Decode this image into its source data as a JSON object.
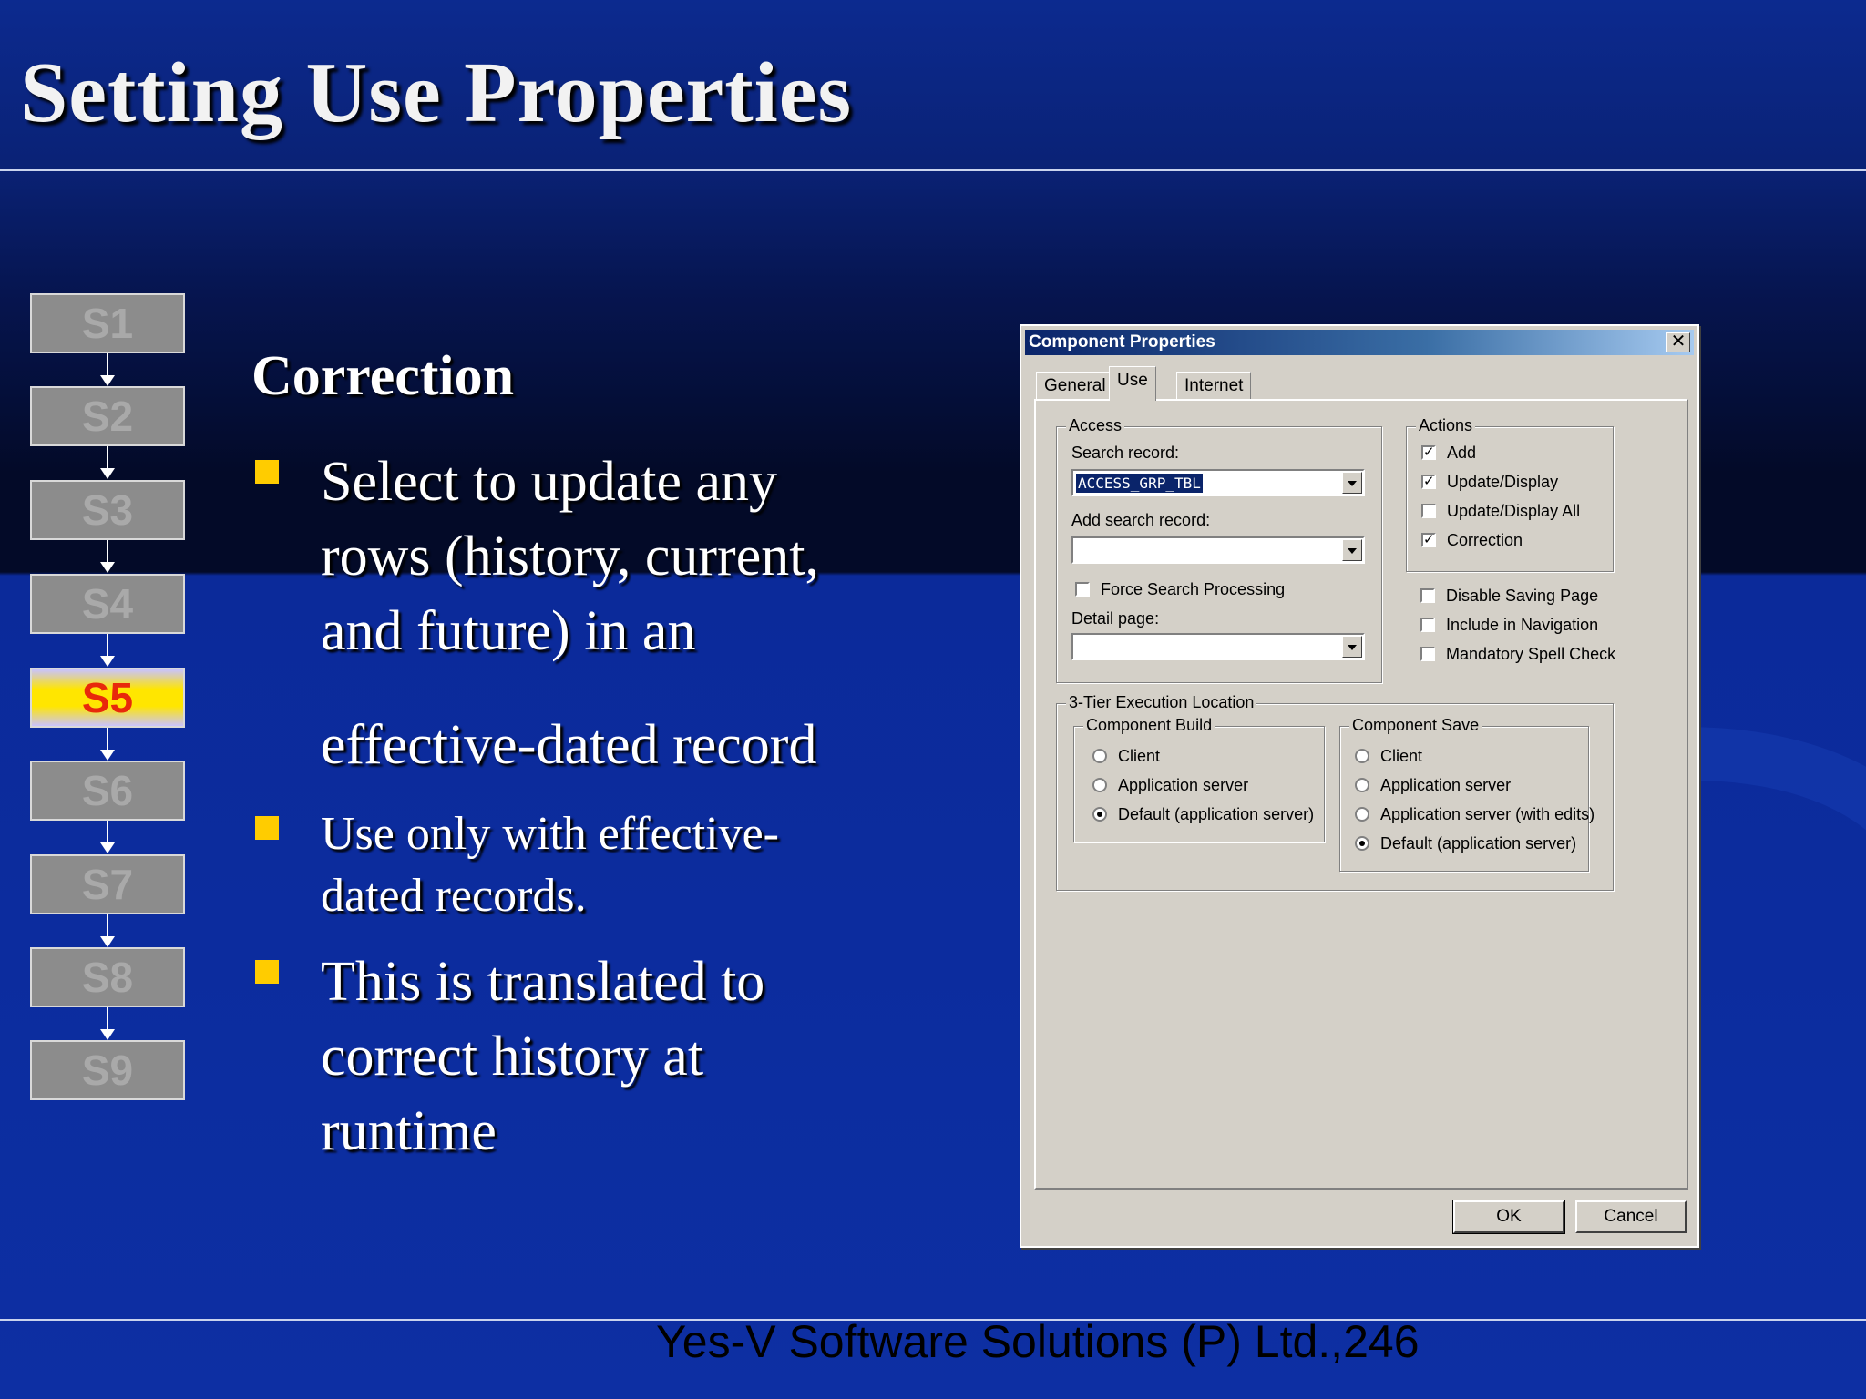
{
  "slide": {
    "title": "Setting Use Properties",
    "heading": "Correction",
    "bullets": [
      {
        "lines": [
          "Select to update any",
          "rows (history, current,",
          "and future) in an"
        ]
      },
      {
        "lines": [
          "effective-dated record"
        ]
      },
      {
        "lines": [
          "Use only with effective-",
          "dated records."
        ]
      },
      {
        "lines": [
          "This is translated to",
          "correct history at",
          "runtime"
        ]
      }
    ],
    "footer": "Yes-V Software Solutions (P) Ltd.,246"
  },
  "steps": [
    "S1",
    "S2",
    "S3",
    "S4",
    "S5",
    "S6",
    "S7",
    "S8",
    "S9"
  ],
  "active_step": "S5",
  "colors": {
    "bullet": "#ffcc00",
    "active_step_text": "#e8290b",
    "active_step_fill": "#ffe600"
  },
  "dialog": {
    "title": "Component Properties",
    "close_glyph": "✕",
    "tabs": [
      "General",
      "Use",
      "Internet"
    ],
    "active_tab": "Use",
    "access": {
      "label": "Access",
      "search_record_label": "Search record:",
      "search_record_value": "ACCESS_GRP_TBL",
      "add_search_record_label": "Add search record:",
      "add_search_record_value": "",
      "force_search_label": "Force Search Processing",
      "force_search_checked": false,
      "detail_page_label": "Detail page:",
      "detail_page_value": ""
    },
    "actions": {
      "label": "Actions",
      "items": [
        {
          "label": "Add",
          "checked": true
        },
        {
          "label": "Update/Display",
          "checked": true
        },
        {
          "label": "Update/Display All",
          "checked": false
        },
        {
          "label": "Correction",
          "checked": true
        }
      ]
    },
    "options": [
      {
        "label": "Disable Saving Page",
        "checked": false
      },
      {
        "label": "Include in Navigation",
        "checked": false
      },
      {
        "label": "Mandatory Spell Check",
        "checked": false
      }
    ],
    "execution": {
      "label": "3-Tier Execution Location",
      "build": {
        "label": "Component Build",
        "options": [
          "Client",
          "Application server",
          "Default (application server)"
        ],
        "selected": 2
      },
      "save": {
        "label": "Component Save",
        "options": [
          "Client",
          "Application server",
          "Application server (with edits)",
          "Default (application server)"
        ],
        "selected": 3
      }
    },
    "buttons": {
      "ok": "OK",
      "cancel": "Cancel"
    }
  }
}
